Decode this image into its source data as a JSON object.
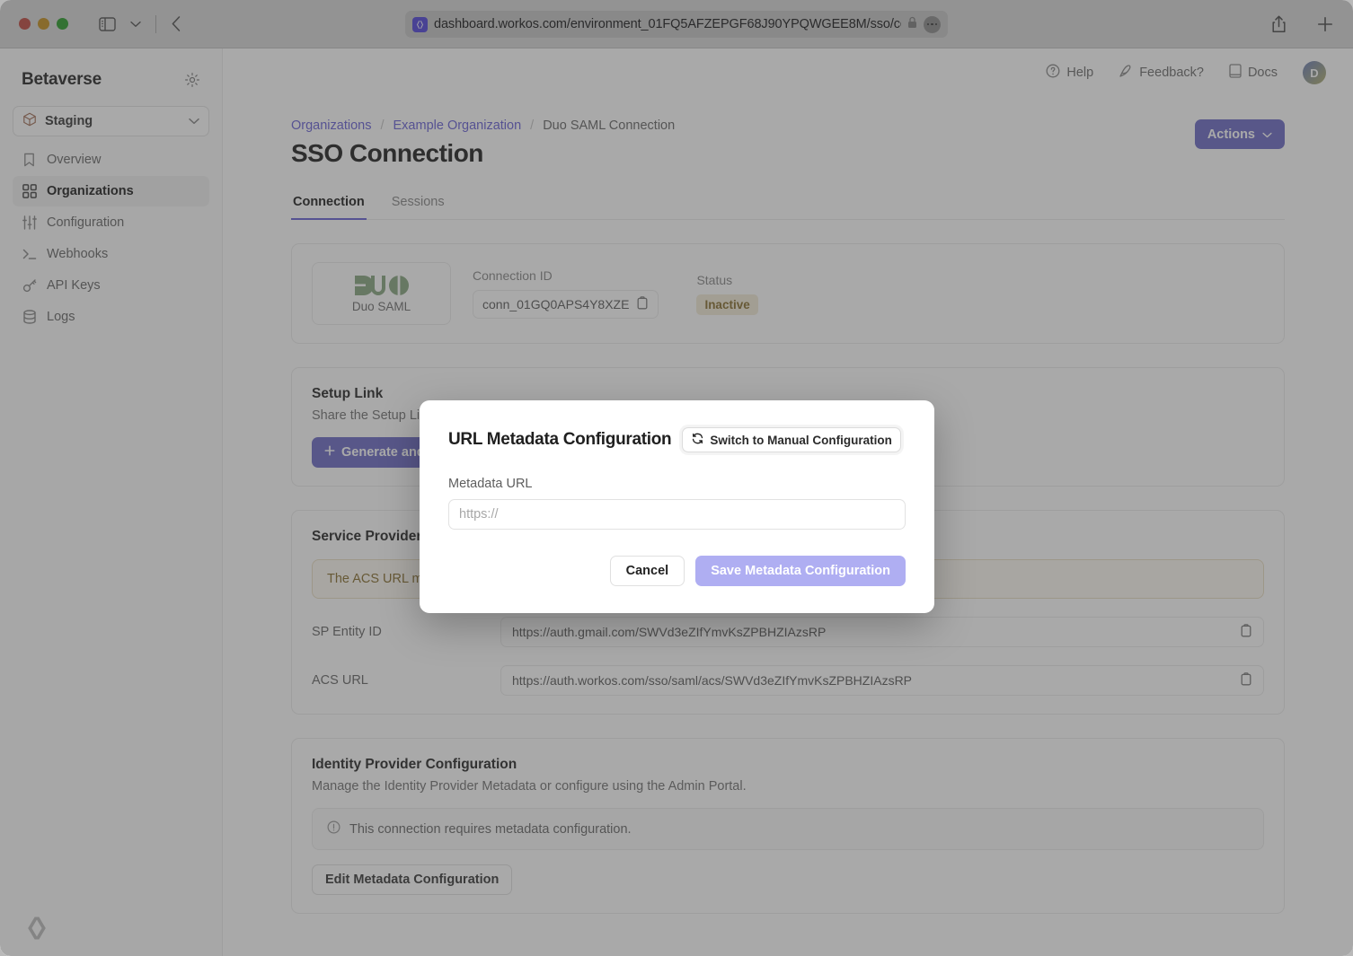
{
  "browser": {
    "url": "dashboard.workos.com/environment_01FQ5AFZEPGF68J90YPQWGEE8M/sso/connecti",
    "traffic_lights": [
      "close",
      "minimize",
      "zoom"
    ],
    "sidebar_toggle_icon": "sidebar-icon",
    "tab_overview_icon": "chevron-down-icon",
    "back_icon": "chevron-left-icon",
    "share_icon": "share-icon",
    "new_tab_icon": "plus-icon",
    "lock_icon": "lock-icon",
    "more_icon": "ellipsis-icon"
  },
  "sidebar": {
    "brand": "Betaverse",
    "settings_icon": "gear-icon",
    "environment": {
      "icon": "cube-icon",
      "label": "Staging",
      "chevron_icon": "chevron-down-icon"
    },
    "items": [
      {
        "label": "Overview",
        "icon": "bookmark-icon",
        "active": false
      },
      {
        "label": "Organizations",
        "icon": "grid-icon",
        "active": true
      },
      {
        "label": "Configuration",
        "icon": "sliders-icon",
        "active": false
      },
      {
        "label": "Webhooks",
        "icon": "terminal-icon",
        "active": false
      },
      {
        "label": "API Keys",
        "icon": "key-icon",
        "active": false
      },
      {
        "label": "Logs",
        "icon": "database-icon",
        "active": false
      }
    ],
    "footer_logo": "workos-logo"
  },
  "topbar": {
    "help": {
      "label": "Help",
      "icon": "question-circle-icon"
    },
    "feedback": {
      "label": "Feedback?",
      "icon": "pen-icon"
    },
    "docs": {
      "label": "Docs",
      "icon": "book-icon"
    },
    "avatar_initial": "D"
  },
  "breadcrumb": {
    "items": [
      "Organizations",
      "Example Organization",
      "Duo SAML Connection"
    ],
    "separator": "/"
  },
  "page": {
    "title": "SSO Connection",
    "actions_button": {
      "label": "Actions",
      "chevron_icon": "chevron-down-icon"
    },
    "tabs": [
      {
        "label": "Connection",
        "active": true
      },
      {
        "label": "Sessions",
        "active": false
      }
    ]
  },
  "connection_card": {
    "provider_logo_text": "DUO",
    "provider_name": "Duo SAML",
    "connection_id_label": "Connection ID",
    "connection_id_value": "conn_01GQ0APS4Y8XZE",
    "copy_icon": "clipboard-icon",
    "status_label": "Status",
    "status_value": "Inactive"
  },
  "setup_link": {
    "title": "Setup Link",
    "description": "Share the Setup Lin",
    "button_label": "Generate and",
    "button_icon": "plus-icon"
  },
  "service_provider": {
    "title": "Service Provider D",
    "callout": "The ACS URL mu",
    "rows": [
      {
        "key": "SP Entity ID",
        "value": "https://auth.gmail.com/SWVd3eZIfYmvKsZPBHZIAzsRP",
        "copy_icon": "clipboard-icon"
      },
      {
        "key": "ACS URL",
        "value": "https://auth.workos.com/sso/saml/acs/SWVd3eZIfYmvKsZPBHZIAzsRP",
        "copy_icon": "clipboard-icon"
      }
    ]
  },
  "identity_provider": {
    "title": "Identity Provider Configuration",
    "description": "Manage the Identity Provider Metadata or configure using the Admin Portal.",
    "callout": "This connection requires metadata configuration.",
    "callout_icon": "info-circle-icon",
    "edit_button_label": "Edit Metadata Configuration"
  },
  "modal": {
    "title": "URL Metadata Configuration",
    "switch_button": {
      "label": "Switch to Manual Configuration",
      "icon": "refresh-swap-icon"
    },
    "field_label": "Metadata URL",
    "input_placeholder": "https://",
    "input_value": "",
    "cancel_label": "Cancel",
    "save_label": "Save Metadata Configuration"
  },
  "colors": {
    "accent": "#6b64d6",
    "accent_button": "#6f6dc6",
    "save_button": "#afaef2",
    "status_inactive_bg": "#f3ecd8",
    "status_inactive_text": "#8a7133",
    "duo_green": "#8aa883",
    "overlay": "rgba(60,60,60,0.44)"
  }
}
